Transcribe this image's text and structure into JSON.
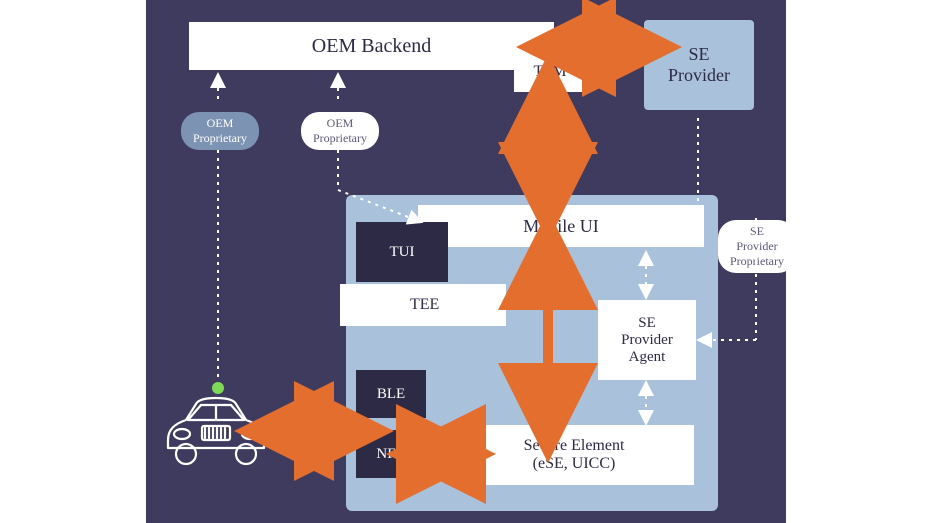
{
  "boxes": {
    "oem_backend": "OEM Backend",
    "tsm": "TSM",
    "se_provider": "SE\nProvider",
    "mobile_ui": "Mobile UI",
    "tee": "TEE",
    "tui": "TUI",
    "ble": "BLE",
    "nfc": "NFC",
    "se_provider_agent": "SE\nProvider\nAgent",
    "secure_element": "Secure Element\n(eSE, UICC)"
  },
  "labels": {
    "oem_prop1": "OEM\nProprietary",
    "oem_prop2": "OEM\nProprietary",
    "se_prov_prop": "SE Provider\nProprietary"
  },
  "colors": {
    "bg": "#3f3b5f",
    "block_dark": "#2c2a44",
    "light_blue": "#a9c1db",
    "arrow": "#e46e2e",
    "dot_green": "#7ed957"
  }
}
